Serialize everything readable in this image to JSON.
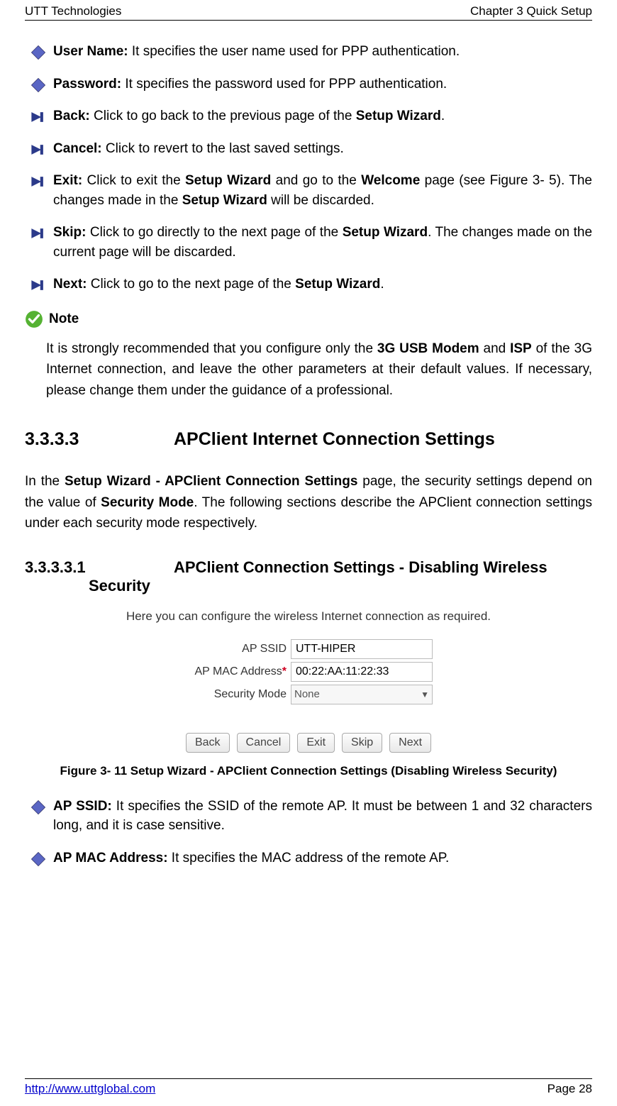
{
  "header": {
    "left": "UTT Technologies",
    "right": "Chapter 3 Quick Setup"
  },
  "items": [
    {
      "type": "diamond",
      "label": "User Name:",
      "text": " It specifies the user name used for PPP authentication."
    },
    {
      "type": "diamond",
      "label": "Password:",
      "text": " It specifies the password used for PPP authentication."
    },
    {
      "type": "arrow",
      "label": "Back:",
      "text_pre": " Click to go back to the previous page of the ",
      "bold1": "Setup Wizard",
      "text_post": "."
    },
    {
      "type": "arrow",
      "label": "Cancel:",
      "text": " Click to revert to the last saved settings."
    },
    {
      "type": "arrow",
      "label": "Exit:",
      "t1": " Click to exit the ",
      "b1": "Setup Wizard",
      "t2": " and go to the ",
      "b2": "Welcome",
      "t3": " page (see Figure 3- 5). The changes made in the ",
      "b3": "Setup Wizard",
      "t4": " will be discarded."
    },
    {
      "type": "arrow",
      "label": "Skip:",
      "t1": " Click to go directly to the next page of the ",
      "b1": "Setup Wizard",
      "t2": ". The changes made on the current page will be discarded."
    },
    {
      "type": "arrow",
      "label": "Next:",
      "t1": " Click to go to the next page of the ",
      "b1": "Setup Wizard",
      "t2": "."
    }
  ],
  "note": {
    "label": "Note",
    "t1": "It is strongly recommended that you configure only the ",
    "b1": "3G USB Modem",
    "t2": " and ",
    "b2": "ISP",
    "t3": " of the 3G Internet connection, and leave the other parameters at their default values. If necessary, please change them under the guidance of a professional."
  },
  "section": {
    "num": "3.3.3.3",
    "title": "APClient Internet Connection Settings"
  },
  "intro": {
    "t1": "In the ",
    "b1": "Setup Wizard - APClient Connection Settings",
    "t2": " page, the security settings depend on the value of ",
    "b2": "Security Mode",
    "t3": ". The following sections describe the APClient connection settings under each security mode respectively."
  },
  "subsection": {
    "num": "3.3.3.3.1",
    "title_line1": "APClient Connection Settings - Disabling Wireless",
    "title_line2": "Security"
  },
  "figure": {
    "intro": "Here you can configure the wireless Internet connection as required.",
    "rows": {
      "ssid_label": "AP SSID",
      "ssid_value": "UTT-HIPER",
      "mac_label": "AP MAC Address",
      "mac_value": "00:22:AA:11:22:33",
      "mode_label": "Security Mode",
      "mode_value": "None"
    },
    "buttons": {
      "back": "Back",
      "cancel": "Cancel",
      "exit": "Exit",
      "skip": "Skip",
      "next": "Next"
    },
    "caption": "Figure 3- 11 Setup Wizard - APClient Connection Settings (Disabling Wireless Security)"
  },
  "post_items": [
    {
      "label": "AP SSID:",
      "text": " It specifies the SSID of the remote AP. It must be between 1 and 32 characters long, and it is case sensitive."
    },
    {
      "label": "AP MAC Address:",
      "text": " It specifies the MAC address of the remote AP."
    }
  ],
  "footer": {
    "link": "http://www.uttglobal.com",
    "page": "Page 28"
  }
}
